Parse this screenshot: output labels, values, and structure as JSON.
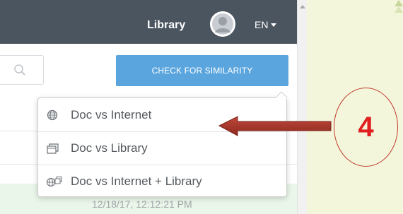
{
  "header": {
    "library_link": "Library",
    "language": "EN"
  },
  "toolbar": {
    "check_button": "CHECK FOR SIMILARITY"
  },
  "menu": {
    "items": [
      {
        "label": "Doc vs Internet",
        "icon": "globe-icon"
      },
      {
        "label": "Doc vs Library",
        "icon": "library-window-icon"
      },
      {
        "label": "Doc vs Internet + Library",
        "icon": "globe-library-icon"
      }
    ]
  },
  "list": {
    "timestamp": "12/18/17, 12:12:21 PM"
  },
  "annotation": {
    "step_number": "4",
    "arrow_color": "#b03a2e"
  },
  "colors": {
    "topbar": "#4a5560",
    "button": "#5aa5dd",
    "slide_background": "#f4f6dc"
  }
}
